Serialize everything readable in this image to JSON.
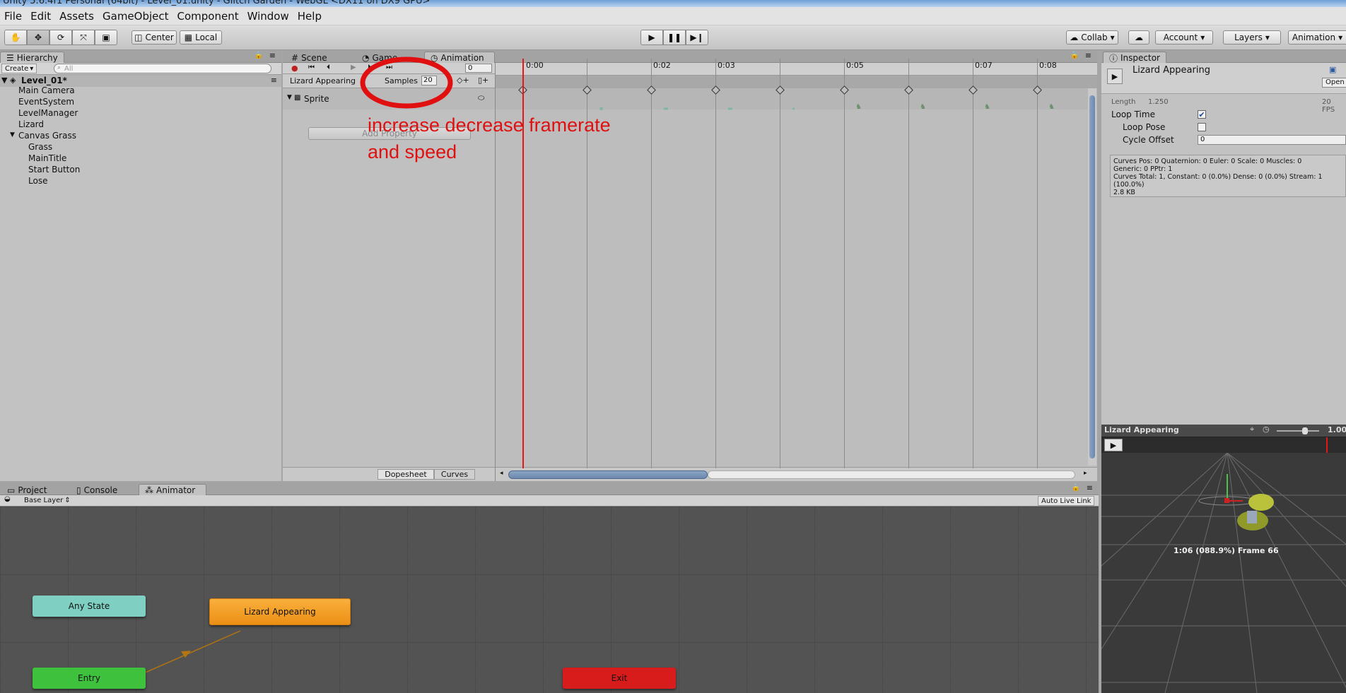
{
  "window": {
    "title": "Unity 5.6.4f1 Personal (64bit) - Level_01.unity - Glitch Garden - WebGL <DX11 on DX9 GPU>"
  },
  "menu": [
    "File",
    "Edit",
    "Assets",
    "GameObject",
    "Component",
    "Window",
    "Help"
  ],
  "toolbar": {
    "center_label": "Center",
    "local_label": "Local",
    "collab_label": "Collab",
    "account_label": "Account",
    "layers_label": "Layers",
    "layout_label": "Animation"
  },
  "hierarchy": {
    "tab": "Hierarchy",
    "create_label": "Create",
    "search_placeholder": "All",
    "scene": "Level_01*",
    "items": [
      "Main Camera",
      "EventSystem",
      "LevelManager",
      "Lizard",
      "Canvas Grass",
      "Grass",
      "MainTitle",
      "Start Button",
      "Lose"
    ]
  },
  "center_tabs": {
    "scene": "Scene",
    "game": "Game",
    "animation": "Animation"
  },
  "animation": {
    "frame_field": "0",
    "clip_name": "Lizard Appearing",
    "samples_label": "Samples",
    "samples_value": "20",
    "property": "Sprite",
    "add_property": "Add Property",
    "dopesheet_label": "Dopesheet",
    "curves_label": "Curves",
    "ruler": [
      "0:00",
      "0:02",
      "0:03",
      "0:05",
      "0:07",
      "0:08"
    ],
    "annotation_line1": "increase decrease framerate",
    "annotation_line2": "and speed",
    "annotation_color": "#e01010"
  },
  "inspector": {
    "tab": "Inspector",
    "title": "Lizard Appearing",
    "open_label": "Open",
    "length_label": "Length",
    "length_value": "1.250",
    "fps": "20 FPS",
    "loop_time_label": "Loop Time",
    "loop_time": true,
    "loop_pose_label": "Loop Pose",
    "loop_pose": false,
    "cycle_offset_label": "Cycle Offset",
    "cycle_offset": "0",
    "info_line1": "Curves Pos: 0 Quaternion: 0 Euler: 0 Scale: 0 Muscles: 0",
    "info_line2": "Generic: 0 PPtr: 1",
    "info_line3": "Curves Total: 1, Constant: 0 (0.0%) Dense: 0 (0.0%) Stream: 1",
    "info_line4": "(100.0%)",
    "info_line5": "2.8 KB"
  },
  "preview": {
    "title": "Lizard Appearing",
    "speed": "1.00",
    "status": "1:06 (088.9%) Frame 66"
  },
  "bottom_tabs": {
    "project": "Project",
    "console": "Console",
    "animator": "Animator"
  },
  "animator": {
    "layer": "Base Layer",
    "auto_live_link": "Auto Live Link",
    "nodes": {
      "any_state": "Any State",
      "entry": "Entry",
      "lizard": "Lizard Appearing",
      "exit": "Exit"
    }
  },
  "colors": {
    "any_state": "#7fd0c2",
    "entry": "#3ec23e",
    "lizard": "#f39a1f",
    "exit": "#d81c1c"
  }
}
